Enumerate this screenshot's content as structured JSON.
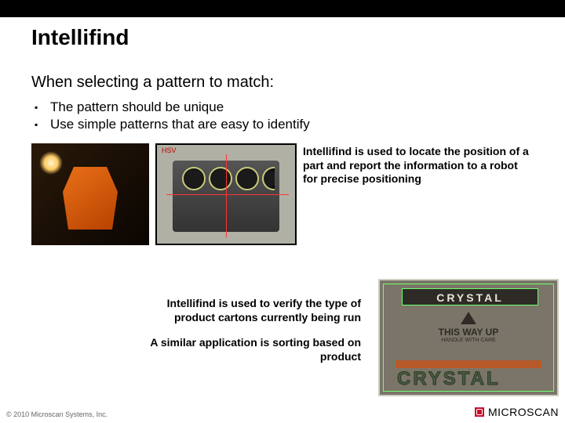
{
  "title": "Intellifind",
  "subhead": "When selecting a pattern to match:",
  "bullets": [
    "The pattern should be unique",
    "Use simple patterns that are easy to identify"
  ],
  "caption_engine": "Intellifind is used to locate the position of a part and report the information to a robot for precise positioning",
  "caption_carton_1": "Intellifind is used to verify the type of product cartons currently being run",
  "caption_carton_2": "A similar application is sorting based on product",
  "carton": {
    "brand": "CRYSTAL",
    "wayup_main": "THIS WAY UP",
    "wayup_sub": "HANDLE WITH CARE",
    "brand2": "CRYSTAL"
  },
  "engine_label": "HSV",
  "footer": {
    "copyright": "© 2010 Microscan Systems, Inc.",
    "logo_text": "MICROSCAN"
  }
}
